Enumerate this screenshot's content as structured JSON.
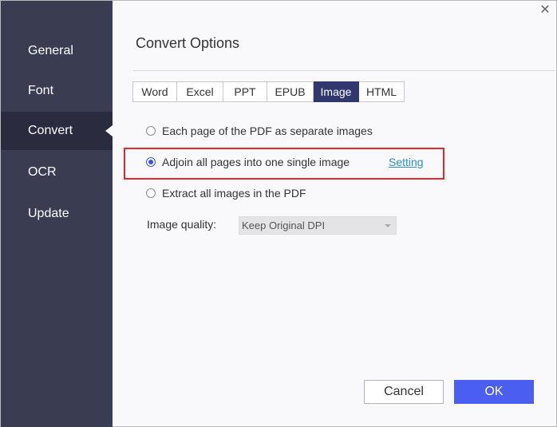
{
  "sidebar": {
    "items": [
      {
        "label": "General",
        "active": false
      },
      {
        "label": "Font",
        "active": false
      },
      {
        "label": "Convert",
        "active": true
      },
      {
        "label": "OCR",
        "active": false
      },
      {
        "label": "Update",
        "active": false
      }
    ]
  },
  "close_icon": "close-icon",
  "main": {
    "title": "Convert Options",
    "tabs": [
      {
        "label": "Word",
        "active": false
      },
      {
        "label": "Excel",
        "active": false
      },
      {
        "label": "PPT",
        "active": false
      },
      {
        "label": "EPUB",
        "active": false
      },
      {
        "label": "Image",
        "active": true
      },
      {
        "label": "HTML",
        "active": false
      }
    ],
    "options": [
      {
        "label": "Each page of the PDF as separate images",
        "checked": false
      },
      {
        "label": "Adjoin all pages into one single image",
        "checked": true
      },
      {
        "label": "Extract all images in the PDF",
        "checked": false
      }
    ],
    "setting_link": "Setting",
    "image_quality": {
      "label": "Image quality:",
      "value": "Keep Original DPI"
    }
  },
  "footer": {
    "cancel_label": "Cancel",
    "ok_label": "OK"
  },
  "colors": {
    "sidebar_bg": "#3a3c52",
    "sidebar_active_bg": "#2a2b3e",
    "tab_active_bg": "#31386e",
    "primary_button": "#4b5ef2",
    "radio_checked": "#3b4ff5",
    "highlight_border": "#e0282d",
    "link": "#2a8fcf"
  }
}
